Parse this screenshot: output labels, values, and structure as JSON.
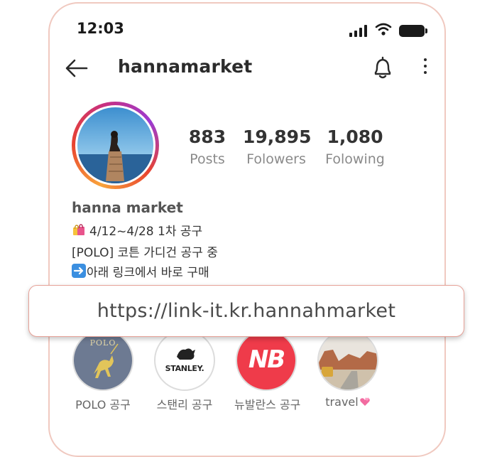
{
  "status": {
    "time": "12:03"
  },
  "header": {
    "username": "hannamarket"
  },
  "stats": [
    {
      "value": "883",
      "label": "Posts"
    },
    {
      "value": "19,895",
      "label": "Folowers"
    },
    {
      "value": "1,080",
      "label": "Folowing"
    }
  ],
  "bio": {
    "name": "hanna market",
    "line1": "4/12~4/28 1차 공구",
    "line2": "[POLO] 코튼 가디건 공구 중",
    "line3": "아래 링크에서 바로 구매"
  },
  "link": {
    "url": "https://link-it.kr.hannahmarket"
  },
  "highlights": [
    {
      "caption": "POLO 공구",
      "logo": "POLO"
    },
    {
      "caption": "스탠리 공구",
      "logo": "STANLEY."
    },
    {
      "caption": "뉴발란스 공구",
      "logo": "NB"
    },
    {
      "caption": "travel",
      "logo": ""
    }
  ],
  "icons": [
    "back-arrow-icon",
    "bell-icon",
    "more-vertical-icon",
    "signal-icon",
    "wifi-icon",
    "battery-icon",
    "shopping-bags-icon",
    "right-arrow-emoji-icon",
    "pink-hearts-icon"
  ],
  "colors": {
    "link_border": "#e6a197",
    "ring_start": "#f9a43b",
    "ring_end": "#9b3bd2",
    "nb_red": "#ef3b4a"
  }
}
